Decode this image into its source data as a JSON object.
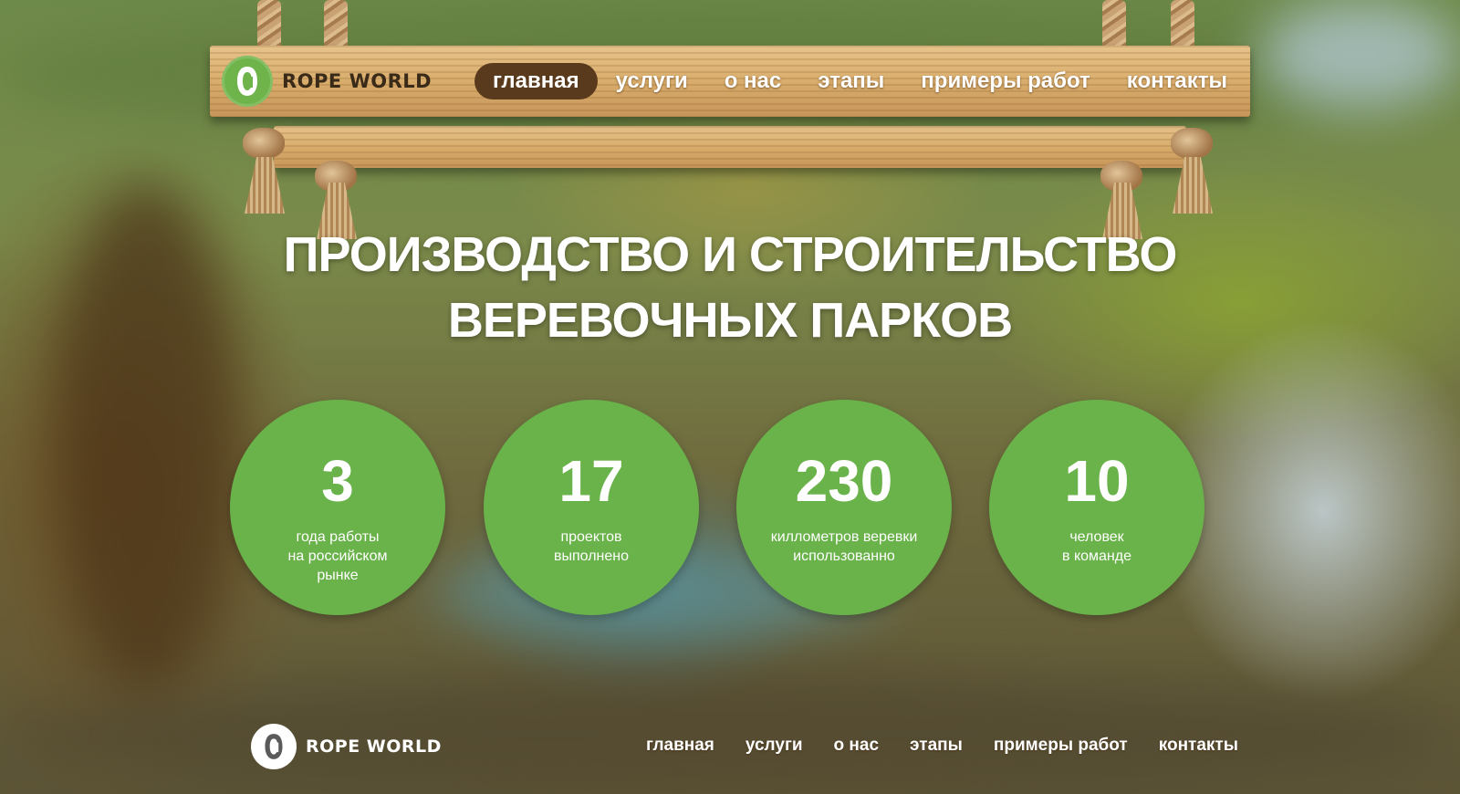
{
  "brand": {
    "name": "ROPE WORLD",
    "accent_color": "#6ab24a",
    "text_color": "#3a2a18",
    "logo_icon": "carabiner-icon"
  },
  "header_nav": {
    "items": [
      {
        "label": "главная",
        "active": true
      },
      {
        "label": "услуги",
        "active": false
      },
      {
        "label": "о нас",
        "active": false
      },
      {
        "label": "этапы",
        "active": false
      },
      {
        "label": "примеры работ",
        "active": false
      },
      {
        "label": "контакты",
        "active": false
      }
    ]
  },
  "hero": {
    "line1": "ПРОИЗВОДСТВО И СТРОИТЕЛЬСТВО",
    "line2": "ВЕРЕВОЧНЫХ ПАРКОВ"
  },
  "stats": [
    {
      "value": "3",
      "label_lines": [
        "года работы",
        "на российском",
        "рынке"
      ]
    },
    {
      "value": "17",
      "label_lines": [
        "проектов",
        "выполнено"
      ]
    },
    {
      "value": "230",
      "label_lines": [
        "киллометров веревки",
        "использованно"
      ]
    },
    {
      "value": "10",
      "label_lines": [
        "человек",
        "в команде"
      ]
    }
  ],
  "footer": {
    "brand_name": "ROPE WORLD",
    "nav": [
      "главная",
      "услуги",
      "о нас",
      "этапы",
      "примеры работ",
      "контакты"
    ]
  }
}
